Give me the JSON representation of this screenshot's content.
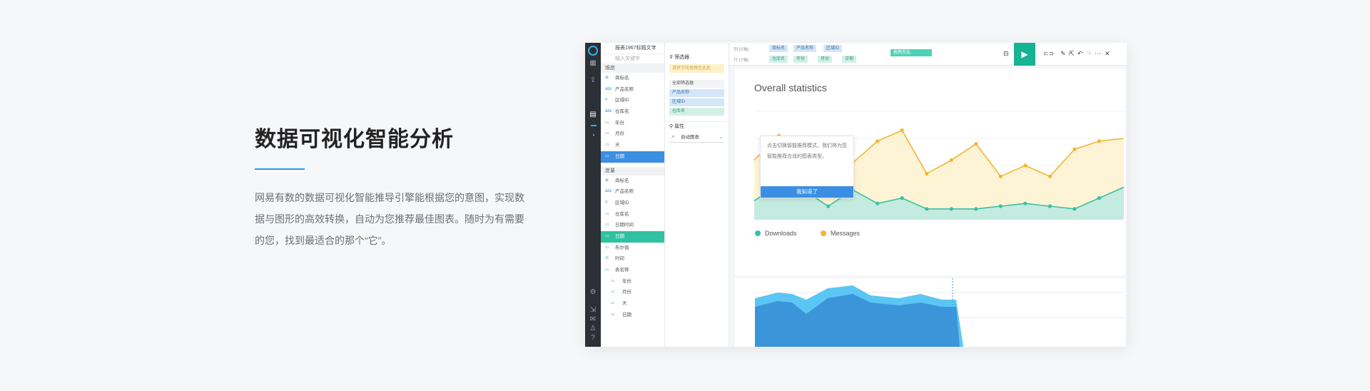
{
  "intro": {
    "title": "数据可视化智能分析",
    "description": "网易有数的数据可视化智能推导引擎能根据您的意图，实现数据与图形的高效转换，自动为您推荐最佳图表。随时为有需要的您，找到最适合的那个“它”。"
  },
  "app": {
    "report_title": "报表1967标题文字",
    "search_placeholder": "输入关键字",
    "dimension_header": "维度",
    "dimensions": [
      {
        "type": "⊕",
        "label": "商标名"
      },
      {
        "type": "abc",
        "label": "产品名称"
      },
      {
        "type": "#",
        "label": "区域ID"
      },
      {
        "type": "abc",
        "label": "仓库名"
      },
      {
        "type": "▭",
        "label": "年份"
      },
      {
        "type": "▭",
        "label": "月份"
      },
      {
        "type": "▭",
        "label": "天"
      },
      {
        "type": "▭",
        "label": "日期"
      }
    ],
    "measure_header": "度量",
    "measures": [
      {
        "type": "⊕",
        "label": "商标名"
      },
      {
        "type": "abc",
        "label": "产品名称"
      },
      {
        "type": "#",
        "label": "区域ID"
      },
      {
        "type": "▭",
        "label": "仓库名"
      },
      {
        "type": "▭",
        "label": "日期时间"
      },
      {
        "type": "▭",
        "label": "日期"
      },
      {
        "type": "▭",
        "label": "布尔值"
      },
      {
        "type": "⊙",
        "label": "时间"
      },
      {
        "type": "▭",
        "label": "表名称"
      },
      {
        "type": "▭",
        "label": "年份"
      },
      {
        "type": "▭",
        "label": "月份"
      },
      {
        "type": "▭",
        "label": "天"
      },
      {
        "type": "▭",
        "label": "日期"
      }
    ],
    "filter": {
      "title": "筛选器",
      "drop_hint": "请将字段拖拽至此处",
      "all_label": "全部筛选器",
      "chips": [
        "产品名称",
        "区域ID",
        "仓库名"
      ]
    },
    "property": {
      "title": "属性",
      "chart_select": "自动图表"
    },
    "shelf": {
      "column_label": "列 (X轴)",
      "row_label": "行 (Y轴)",
      "column_pills": [
        "商标名",
        "产品名称",
        "区域ID"
      ],
      "row_pills": [
        "仓库名",
        "年份",
        "月份",
        "日期"
      ],
      "drop_hint": "拖拽至此"
    },
    "chart": {
      "title": "Overall statistics",
      "tooltip_text": "点击切换智能推荐模式，我们将为您智能推荐合适的图表类型。",
      "tooltip_button": "我知道了",
      "legend": [
        {
          "name": "Downloads",
          "color": "#3cbfa6"
        },
        {
          "name": "Messages",
          "color": "#f2b631"
        }
      ]
    }
  },
  "chart_data": {
    "type": "line",
    "title": "Overall statistics",
    "x": [
      0,
      1,
      2,
      3,
      4,
      5,
      6,
      7,
      8,
      9,
      10,
      11,
      12,
      13,
      14,
      15
    ],
    "ylim": [
      0,
      4
    ],
    "series": [
      {
        "name": "Messages",
        "values": [
          2.2,
          3.1,
          2.4,
          2.6,
          2.1,
          2.9,
          3.3,
          1.7,
          2.2,
          2.8,
          1.6,
          2.0,
          1.6,
          2.6,
          2.9,
          3.0
        ]
      },
      {
        "name": "Downloads",
        "values": [
          0.7,
          1.3,
          1.1,
          0.5,
          1.1,
          0.6,
          0.8,
          0.4,
          0.4,
          0.4,
          0.5,
          0.6,
          0.5,
          0.4,
          0.8,
          1.2
        ]
      }
    ]
  }
}
